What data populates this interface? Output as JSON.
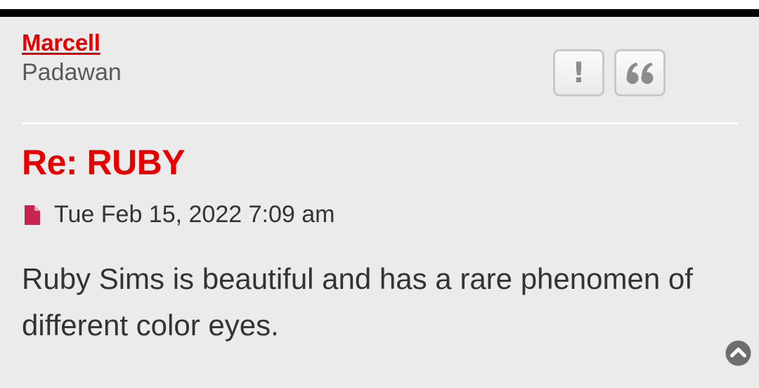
{
  "post": {
    "author": {
      "name": "Marcell",
      "rank": "Padawan"
    },
    "actions": {
      "report_label": "!",
      "report_icon": "exclamation-icon",
      "quote_icon": "quote-icon"
    },
    "title": "Re: RUBY",
    "meta": {
      "icon": "file-icon",
      "date": "Tue Feb 15, 2022 7:09 am"
    },
    "content": "Ruby Sims is beautiful and has a rare phenomen of different color eyes."
  },
  "page": {
    "scroll_top_icon": "chevron-up-circle-icon"
  },
  "colors": {
    "accent": "#e60000",
    "post_background": "#ebebeb",
    "text": "#333333",
    "rank_text": "#5a5a5a",
    "file_icon": "#c7254e",
    "button_icon": "#8c8c8c",
    "top_bar": "#000000"
  }
}
